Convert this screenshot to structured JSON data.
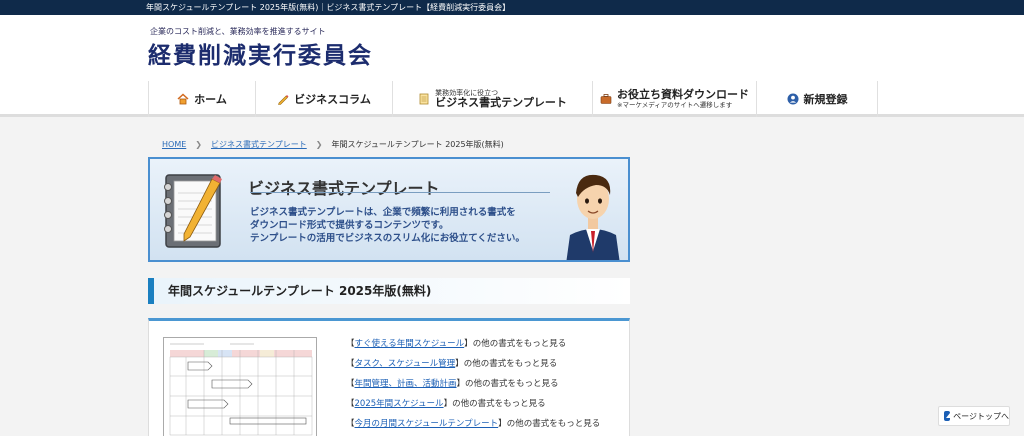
{
  "topbar": {
    "text": "年間スケジュールテンプレート 2025年版(無料)｜ビジネス書式テンプレート【経費削減実行委員会】"
  },
  "header": {
    "tagline": "企業のコスト削減と、業務効率を推進するサイト",
    "logo": "経費削減実行委員会"
  },
  "nav": {
    "home": "ホーム",
    "column": "ビジネスコラム",
    "template_small": "業務効率化に役立つ",
    "template": "ビジネス書式テンプレート",
    "download": "お役立ち資料ダウンロード",
    "download_sub": "※マーケメディアのサイトへ遷移します",
    "register": "新規登録"
  },
  "breadcrumb": {
    "home": "HOME",
    "template": "ビジネス書式テンプレート",
    "current": "年間スケジュールテンプレート 2025年版(無料)"
  },
  "banner": {
    "title": "ビジネス書式テンプレート",
    "desc1": "ビジネス書式テンプレートは、企業で頻繁に利用される書式を",
    "desc2": "ダウンロード形式で提供するコンテンツです。",
    "desc3": "テンプレートの活用でビジネスのスリム化にお役立てください。"
  },
  "heading": "年間スケジュールテンプレート 2025年版(無料)",
  "links": [
    {
      "open": "【",
      "link": "すぐ使える年間スケジュール",
      "close": "】",
      "suffix": "の他の書式をもっと見る"
    },
    {
      "open": "【",
      "link": "タスク、スケジュール管理",
      "close": "】",
      "suffix": "の他の書式をもっと見る"
    },
    {
      "open": "【",
      "link": "年間管理、計画、活動計画",
      "close": "】",
      "suffix": "の他の書式をもっと見る"
    },
    {
      "open": "【",
      "link": "2025年間スケジュール",
      "close": "】",
      "suffix": "の他の書式をもっと見る"
    },
    {
      "open": "【",
      "link": "今月の月間スケジュールテンプレート",
      "close": "】",
      "suffix": "の他の書式をもっと見る"
    }
  ],
  "pagetop": "ページトップへ",
  "colors": {
    "navy": "#0f2a4a",
    "logo": "#1c2c6e",
    "accent": "#1a7fc0",
    "link": "#1b5fb5"
  }
}
